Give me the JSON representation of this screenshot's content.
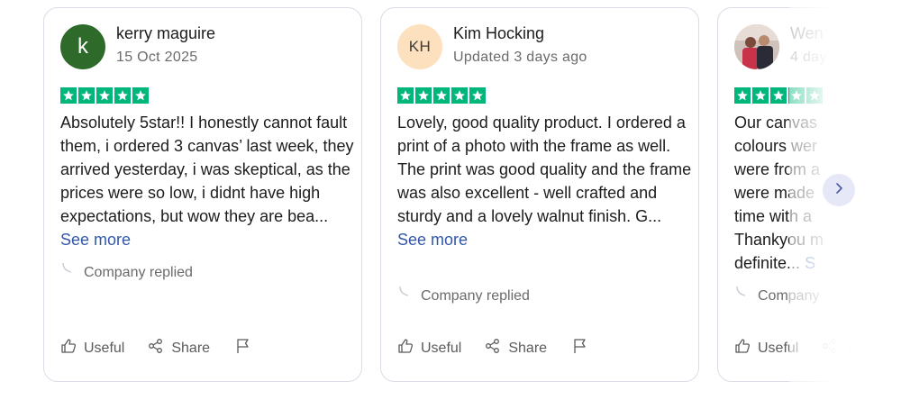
{
  "colors": {
    "star_bg": "#00b67a",
    "link": "#3257a8",
    "avatar_k": "#2e6b2a",
    "avatar_kh": "#fde0bd"
  },
  "reviews": [
    {
      "avatar": {
        "initials": "k"
      },
      "name": "kerry maguire",
      "date": "15 Oct 2025",
      "rating": 5,
      "text": "Absolutely 5star!! I honestly cannot fault them, i ordered 3 canvas’ last week, they arrived yesterday, i was skeptical, as the prices were so low, i didnt have high expectations, but wow they are bea...",
      "see_more": "See more",
      "company_replied": "Company replied",
      "useful_label": "Useful",
      "share_label": "Share"
    },
    {
      "avatar": {
        "initials": "KH"
      },
      "name": "Kim Hocking",
      "date": "Updated 3 days ago",
      "rating": 5,
      "text": "Lovely, good quality product. I ordered a print of a photo with the frame as well. The print was good quality and the frame was also excellent - well crafted and sturdy and a lovely walnut finish. G...",
      "see_more": "See more",
      "company_replied": "Company replied",
      "useful_label": "Useful",
      "share_label": "Share"
    },
    {
      "avatar": {
        "image": "photo"
      },
      "name": "Wen",
      "date": "4 day",
      "rating": 5,
      "text_lines": [
        "Our canvas",
        "colours wer",
        "were from a",
        "were made",
        "time with a",
        "Thankyou m",
        "definite..."
      ],
      "see_more": "S",
      "company_replied": "Company",
      "useful_label": "Useful",
      "share_label": "Share"
    }
  ],
  "navigation": {
    "next_icon": "chevron-right-icon"
  }
}
